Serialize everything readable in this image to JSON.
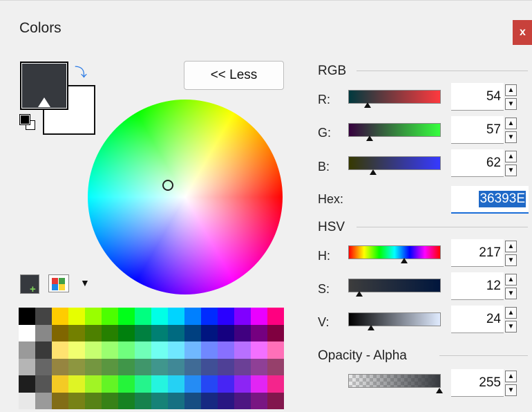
{
  "window": {
    "title": "Colors",
    "close_label": "x"
  },
  "less_button": {
    "label": "<< Less"
  },
  "colors": {
    "primary": "#36393E",
    "secondary": "#FFFFFF",
    "accent": "#1F69C7"
  },
  "rgb": {
    "section_label": "RGB",
    "r": {
      "label": "R:",
      "value": "54"
    },
    "g": {
      "label": "G:",
      "value": "57"
    },
    "b": {
      "label": "B:",
      "value": "62"
    },
    "hex_label": "Hex:",
    "hex_value": "36393E"
  },
  "hsv": {
    "section_label": "HSV",
    "h": {
      "label": "H:",
      "value": "217"
    },
    "s": {
      "label": "S:",
      "value": "12"
    },
    "v": {
      "label": "V:",
      "value": "24"
    }
  },
  "alpha": {
    "section_label": "Opacity - Alpha",
    "value": "255"
  },
  "icons": [
    "swap-colors-icon",
    "reset-colors-icon",
    "add-to-palette-icon",
    "palette-icon",
    "dropdown-arrow-icon",
    "spin-up-icon",
    "spin-down-icon"
  ]
}
